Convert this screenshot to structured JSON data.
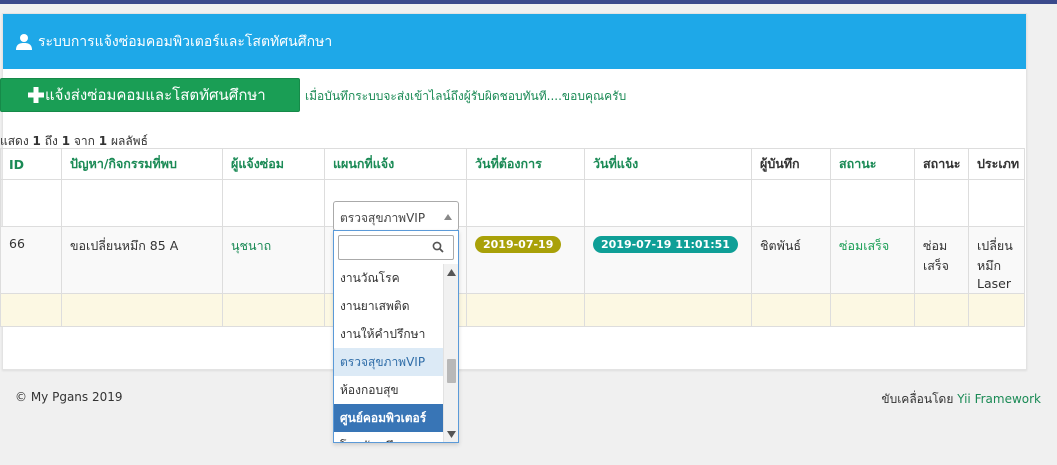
{
  "panel": {
    "title": "ระบบการแจ้งซ่อมคอมพิวเตอร์และโสตทัศนศึกษา",
    "add_button": "แจ้งส่งซ่อมคอมและโสตทัศนศึกษา",
    "notice": "เมื่อบันทึกระบบจะส่งเข้าไลน์ถึงผู้รับผิดชอบทันที....ขอบคุณครับ"
  },
  "summary": {
    "prefix": "แสดง",
    "from": "1",
    "to_word": "ถึง",
    "to": "1",
    "of_word": "จาก",
    "total": "1",
    "suffix": "ผลลัพธ์"
  },
  "columns": [
    "ID",
    "ปัญหา/กิจกรรมที่พบ",
    "ผู้แจ้งซ่อม",
    "แผนกที่แจ้ง",
    "วันที่ต้องการ",
    "วันที่แจ้ง",
    "ผู้บันทึก",
    "สถานะ",
    "สถานะ",
    "ประเภท"
  ],
  "row": {
    "id": "66",
    "problem": "ขอเปลี่ยนหมึก 85 A",
    "reporter": "นุชนาถ",
    "date_needed": "2019-07-19",
    "date_reported": "2019-07-19 11:01:51",
    "recorder": "ชิตพันธ์",
    "status1": "ซ่อมเสร็จ",
    "status2": "ซ่อม เสร็จ",
    "type": "เปลี่ยน หมึก Laser"
  },
  "department_filter": {
    "selected_value": "ตรวจสุขภาพVIP",
    "search_value": "",
    "options": [
      "งานวัณโรค",
      "งานยาเสพติด",
      "งานให้คำปรึกษา",
      "ตรวจสุขภาพVIP",
      "ห้องกอบสุข",
      "ศูนย์คอมพิวเตอร์",
      "โสตทัศนศึกษา"
    ],
    "highlighted_option": "ตรวจสุขภาพVIP",
    "selected_option": "ศูนย์คอมพิวเตอร์"
  },
  "footer": {
    "copyright": "© My Pgans 2019",
    "powered_prefix": "ขับเคลื่อนโดย",
    "powered_link": "Yii Framework"
  },
  "colors": {
    "heading": "#1ea8e8",
    "button": "#1a9e55",
    "link": "#1a8a55",
    "badge_date": "#a9a109",
    "badge_datetime": "#0f9f97",
    "selected_option": "#3875b6"
  },
  "icons": {
    "heading": "user-icon",
    "button": "plus-icon",
    "search": "search-icon"
  }
}
